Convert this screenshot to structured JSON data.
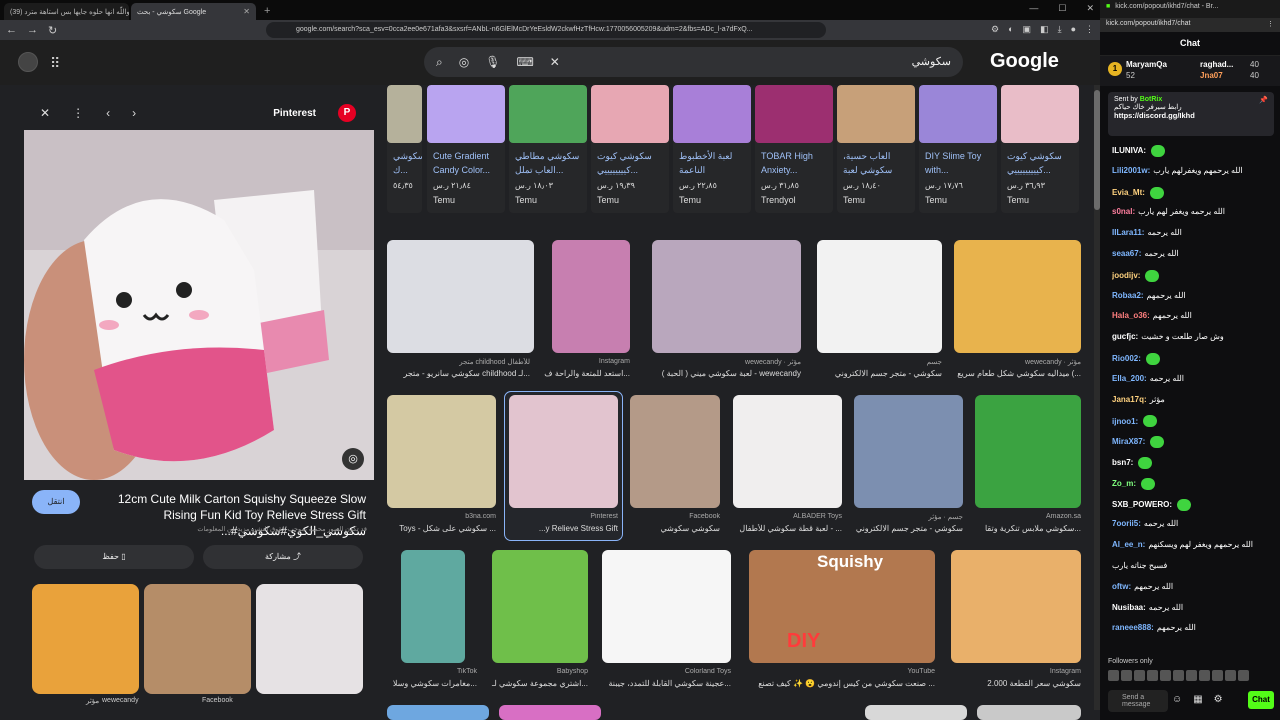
{
  "browser": {
    "tabs": [
      {
        "title": "(39) واللّه انها حلوه جايها بس استاهة مترد"
      },
      {
        "title": "سكوشي - بحث Google"
      }
    ],
    "new_tab": "+",
    "url": "google.com/search?sca_esv=0cca2ee0e671afa3&sxsrf=ANbL-n6GlElMcDrYeEsldW2ckwfHzTfHcw:1770056005209&udm=2&fbs=ADc_l-a7dFxQ..."
  },
  "google": {
    "logo": "Google",
    "query": "سكوشي"
  },
  "panel": {
    "source": "Pinterest",
    "title": "12cm Cute Milk Carton Squishy Squeeze Slow Rising Fun Kid Toy Relieve Stress Gift ...#سكوشي_الكوي#سكوشي",
    "note": "قد تكون الصور محمية بموجب حقوق النشر. مزيد من المعلومات",
    "visit_label": "انتقل",
    "save_label": "حفظ",
    "share_label": "مشاركة",
    "related_sources": [
      "مؤثر",
      "wewecandy",
      "Facebook"
    ]
  },
  "carousel": [
    {
      "title": "سكوشي ك...",
      "price": "٥٤٫٣٥",
      "store": "Temu"
    },
    {
      "title": "Cute Gradient Candy Color...",
      "price": "٢١٫٨٤ ر.س",
      "store": "Temu"
    },
    {
      "title": "سكوشي مطاطي العاب تملل...",
      "price": "١٨٫٠٣ ر.س",
      "store": "Temu"
    },
    {
      "title": "سكوشي كيوت كييييييييي...",
      "price": "١٩٫٣٩ ر.س",
      "store": "Temu"
    },
    {
      "title": "لعبة الأخطبوط الناعمة هيفن.CL...",
      "price": "٢٢٫٨٥ ر.س",
      "store": "Temu"
    },
    {
      "title": "TOBAR High Anxiety...",
      "price": "٣١٫٨٥ ر.س",
      "store": "Trendyol"
    },
    {
      "title": "العاب حسية، سكوشي لعبة لعب...",
      "price": "١٨٫٤٠ ر.س",
      "store": "Temu"
    },
    {
      "title": "DIY Slime Toy with...",
      "price": "١٧٫٧٦ ر.س",
      "store": "Temu"
    },
    {
      "title": "سكوشي كيوت كيييييييييي...",
      "price": "٣٦٫٩٣ ر.س",
      "store": "Temu"
    }
  ],
  "grid": {
    "row1": [
      {
        "src": "متجر childhood للأطفال",
        "cap": "سكوشي سانريو - متجر childhood لـ..."
      },
      {
        "src": "Instagram",
        "cap": "استعد للمتعة والراحة ف..."
      },
      {
        "src": "wewecandy · مؤثر",
        "cap": "لعبة سكوشي ميني ( الحبة ) - wewecandy"
      },
      {
        "src": "جسم",
        "cap": "سكوشي - متجر جسم الالكتروني"
      },
      {
        "src": "wewecandy · مؤثر",
        "cap": "ميداليه سكوشي شكل طعام سريع (..."
      }
    ],
    "row2": [
      {
        "src": "b3na.com",
        "cap": "Toys - سكوشي على شكل ..."
      },
      {
        "src": "Pinterest",
        "cap": "...y Relieve Stress Gift"
      },
      {
        "src": "Facebook",
        "cap": "سكوشي سكوشي"
      },
      {
        "src": "ALBADER Toys",
        "cap": "لعبة قطة سكوشي للأطفال - ..."
      },
      {
        "src": "جسم · مؤثر",
        "cap": "سكوشي - متجر جسم الالكتروني"
      },
      {
        "src": "Amazon.sa",
        "cap": "سكوشي ملابس تنكرية وتقا..."
      }
    ],
    "row3": [
      {
        "src": "TikTok",
        "cap": "مغامرات سكوشي وسلا..."
      },
      {
        "src": "Babyshop",
        "cap": "اشتري مجموعة سكوشي لـ..."
      },
      {
        "src": "Colorland Toys",
        "cap": "عجينة سكوشي القابلة للتمدد، جيبنة..."
      },
      {
        "src": "YouTube",
        "cap": "صنعت سكوشي من كيس إندومي 😮 ✨ كيف تصنع ..."
      },
      {
        "src": "Instagram",
        "cap": "سكوشي سعر القطعة 2.000"
      }
    ],
    "tile_labels": [
      "Squishy",
      "DIY"
    ]
  },
  "kick": {
    "window_title": "kick.com/popout/ikhd7/chat - Br...",
    "url": "kick.com/popout/ikhd7/chat",
    "chat_title": "Chat",
    "leaderboard": [
      {
        "rank": "1",
        "name": "MaryamQa",
        "score": "52"
      },
      {
        "name": "raghad...",
        "score": "40"
      },
      {
        "name": "Jna07",
        "score": "40"
      }
    ],
    "pinned_by": "Sent by",
    "pinned_user": "BotRix",
    "pinned_text": "رابط سيرفر خاك حياكم",
    "pinned_link": "https://discord.gg/Ikhd",
    "messages": [
      {
        "user": "ILUNIVA:",
        "text": "",
        "color": "#ffffff"
      },
      {
        "user": "Lili2001w:",
        "text": "الله يرحمهم ويغفرلهم يارب",
        "color": "#7fb7ff"
      },
      {
        "user": "Evia_Mt:",
        "text": "",
        "color": "#ffd27f"
      },
      {
        "user": "s0nal:",
        "text": "الله يرحمه ويغفر لهم يارب",
        "color": "#ff7f9f"
      },
      {
        "user": "IILara11:",
        "text": "الله يرحمه",
        "color": "#7fb7ff"
      },
      {
        "user": "seaa67:",
        "text": "الله يرحمه",
        "color": "#7fb7ff"
      },
      {
        "user": "joodijv:",
        "text": "",
        "color": "#ffd27f"
      },
      {
        "user": "Robaa2:",
        "text": "الله يرحمهم",
        "color": "#7fb7ff"
      },
      {
        "user": "Hala_o36:",
        "text": "الله يرحمهم",
        "color": "#ff7f7f"
      },
      {
        "user": "gucfjc:",
        "text": "وش صار طلعت و خشيت",
        "color": "#ffffff"
      },
      {
        "user": "Rio002:",
        "text": "",
        "color": "#7fb7ff"
      },
      {
        "user": "Ella_200:",
        "text": "الله يرحمه",
        "color": "#7fb7ff"
      },
      {
        "user": "Jana17q:",
        "text": "مؤثر",
        "color": "#ffd27f"
      },
      {
        "user": "ijnoo1:",
        "text": "",
        "color": "#7fb7ff"
      },
      {
        "user": "MiraX87:",
        "text": "",
        "color": "#7fb7ff"
      },
      {
        "user": "bsn7:",
        "text": "",
        "color": "#ffffff"
      },
      {
        "user": "Zo_m:",
        "text": "",
        "color": "#7fff7f"
      },
      {
        "user": "SXB_POWERO:",
        "text": "",
        "color": "#ffffff"
      },
      {
        "user": "7oorii5:",
        "text": "الله يرحمه",
        "color": "#7fb7ff"
      },
      {
        "user": "Al_ee_n:",
        "text": "الله يرحمهم ويغفر لهم ويسكنهم",
        "color": "#7fb7ff"
      },
      {
        "user": "",
        "text": "فسيح جناته يارب",
        "color": "#ffffff"
      },
      {
        "user": "oftw:",
        "text": "الله يرحمهم",
        "color": "#7fb7ff"
      },
      {
        "user": "Nusibaa:",
        "text": "الله يرحمه",
        "color": "#ffffff"
      },
      {
        "user": "raneee888:",
        "text": "الله يرحمهم",
        "color": "#7fb7ff"
      }
    ],
    "followers_only": "Followers only",
    "input_placeholder": "Send a message",
    "send_label": "Chat"
  }
}
